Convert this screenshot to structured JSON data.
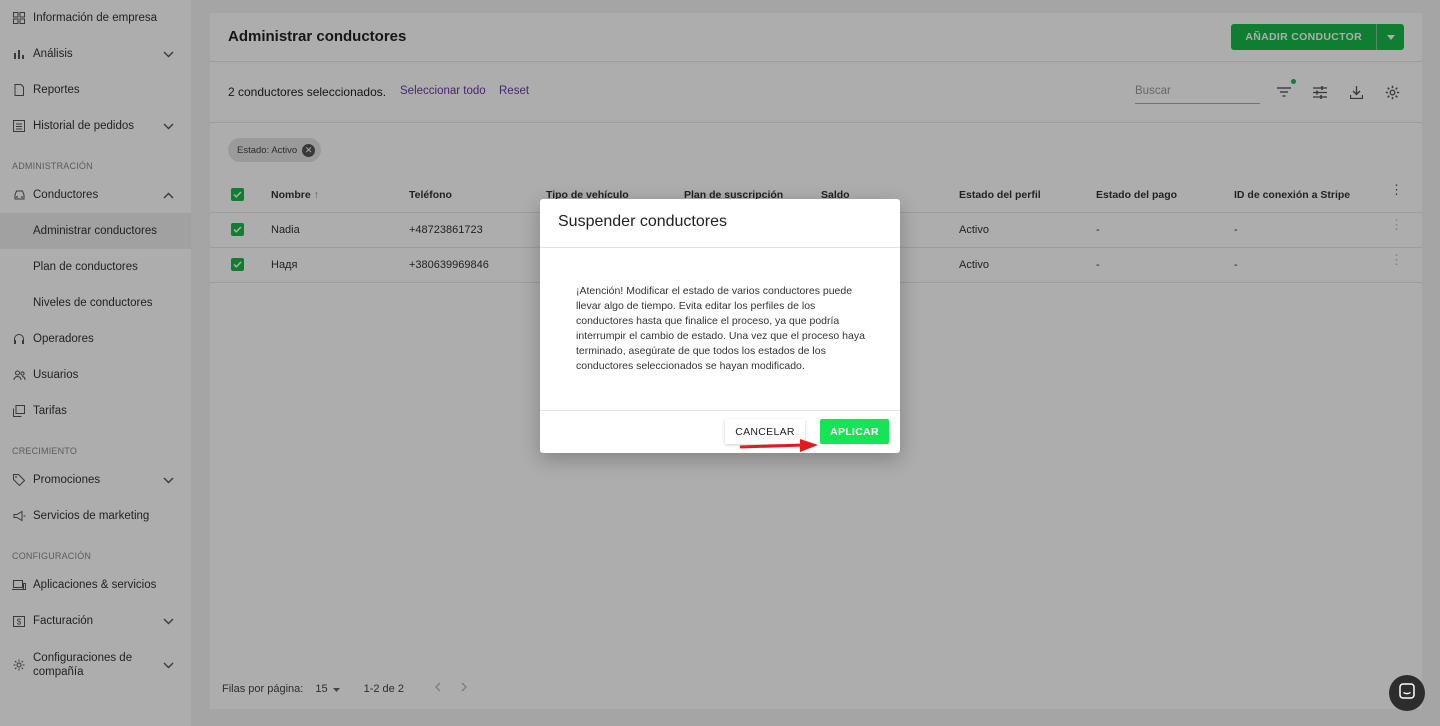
{
  "sidebar": {
    "items": [
      {
        "label": "Información de empresa",
        "icon": "dashboard-icon"
      },
      {
        "label": "Análisis",
        "icon": "bar-chart-icon",
        "chevron": "down"
      },
      {
        "label": "Reportes",
        "icon": "document-icon"
      },
      {
        "label": "Historial de pedidos",
        "icon": "list-icon",
        "chevron": "down"
      },
      {
        "label": "Conductores",
        "icon": "car-icon",
        "chevron": "up"
      },
      {
        "label": "Administrar conductores",
        "active": true
      },
      {
        "label": "Plan de conductores"
      },
      {
        "label": "Niveles de conductores"
      },
      {
        "label": "Operadores",
        "icon": "headset-icon"
      },
      {
        "label": "Usuarios",
        "icon": "users-icon"
      },
      {
        "label": "Tarifas",
        "icon": "tariff-icon"
      },
      {
        "label": "Promociones",
        "icon": "tag-icon",
        "chevron": "down"
      },
      {
        "label": "Servicios de marketing",
        "icon": "megaphone-icon"
      },
      {
        "label": "Aplicaciones & servicios",
        "icon": "devices-icon"
      },
      {
        "label": "Facturación",
        "icon": "billing-icon",
        "chevron": "down"
      },
      {
        "label": "Configuraciones de compañía",
        "icon": "gear-icon",
        "chevron": "down"
      }
    ],
    "sections": {
      "admin": "ADMINISTRACIÓN",
      "growth": "CRECIMIENTO",
      "config": "CONFIGURACIÓN"
    }
  },
  "header": {
    "title": "Administrar conductores",
    "add_button": "AÑADIR CONDUCTOR"
  },
  "toolbar": {
    "selected_text": "2 conductores seleccionados.",
    "select_all": "Seleccionar todo",
    "reset": "Reset",
    "search_placeholder": "Buscar"
  },
  "filter_chip": "Estado: Activo",
  "table": {
    "columns": [
      "Nombre",
      "Teléfono",
      "Tipo de vehículo",
      "Plan de suscripción",
      "Saldo",
      "Estado del perfil",
      "Estado del pago",
      "ID de conexión a Stripe"
    ],
    "rows": [
      {
        "name": "Nadia",
        "phone": "+48723861723",
        "status": "Activo",
        "payment": "-",
        "stripe": "-"
      },
      {
        "name": "Надя",
        "phone": "+380639969846",
        "status": "Activo",
        "payment": "-",
        "stripe": "-"
      }
    ]
  },
  "footer": {
    "rows_per_page_label": "Filas por página:",
    "rows_per_page": "15",
    "range": "1-2 de 2"
  },
  "dialog": {
    "title": "Suspender conductores",
    "body": "¡Atención! Modificar el estado de varios conductores puede llevar algo de tiempo. Evita editar los perfiles de los conductores hasta que finalice el proceso, ya que podría interrumpir el cambio de estado. Una vez que el proceso haya terminado, asegúrate de que todos los estados de los conductores seleccionados se hayan modificado.",
    "cancel": "CANCELAR",
    "apply": "APLICAR"
  },
  "colors": {
    "accent": "#17b94b",
    "apply_button": "#17e356",
    "link": "#6a3aa0",
    "arrow": "#e01b1b"
  }
}
